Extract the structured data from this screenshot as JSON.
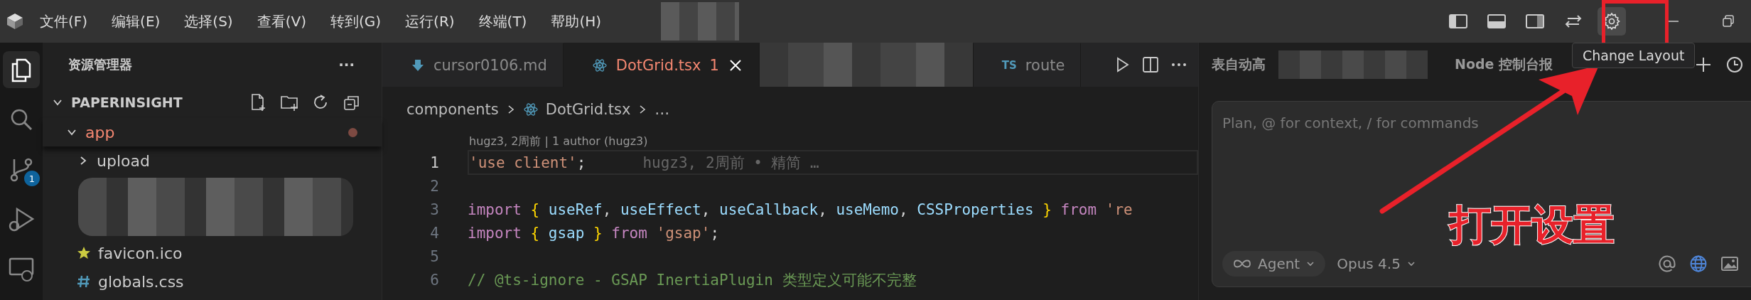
{
  "menu": [
    "文件(F)",
    "编辑(E)",
    "选择(S)",
    "查看(V)",
    "转到(G)",
    "运行(R)",
    "终端(T)",
    "帮助(H)"
  ],
  "title_bar_icons": [
    {
      "kind": "sidebar-left",
      "selected": false
    },
    {
      "kind": "panel",
      "selected": false
    },
    {
      "kind": "sidebar-right",
      "selected": false
    },
    {
      "kind": "swap",
      "selected": false
    },
    {
      "kind": "gear",
      "selected": true
    }
  ],
  "activity_bar": [
    {
      "kind": "explorer",
      "selected": true
    },
    {
      "kind": "search",
      "selected": false
    },
    {
      "kind": "source-control",
      "selected": false,
      "badge": "1"
    },
    {
      "kind": "debug",
      "selected": false
    },
    {
      "kind": "remote",
      "selected": false
    }
  ],
  "sidebar": {
    "title": "资源管理器",
    "more": "···",
    "root": {
      "label": "PAPERINSIGHT",
      "expanded": true,
      "children": [
        {
          "kind": "folder",
          "label": "app",
          "expanded": true,
          "modified": true,
          "children": [
            {
              "kind": "folder",
              "label": "upload",
              "expanded": false
            },
            {
              "kind": "redacted"
            },
            {
              "kind": "favicon",
              "label": "favicon.ico"
            },
            {
              "kind": "css",
              "label": "globals.css"
            }
          ]
        }
      ]
    }
  },
  "editor": {
    "tabs": [
      {
        "kind": "md",
        "label": "cursor0106.md",
        "selected": false
      },
      {
        "kind": "react",
        "label": "DotGrid.tsx",
        "problems": "1",
        "selected": true
      },
      {
        "kind": "redacted"
      },
      {
        "kind": "ts",
        "icon_text": "TS",
        "label": "route",
        "selected": false
      }
    ],
    "breadcrumb": [
      "components",
      "DotGrid.tsx",
      "…"
    ],
    "codelens": "hugz3, 2周前 | 1 author (hugz3)",
    "lines": [
      {
        "number": "1",
        "current": true,
        "blame": "hugz3, 2周前 • 精简 …",
        "tokens": [
          {
            "kind": "string",
            "text": "'use client'"
          },
          {
            "kind": "punct",
            "text": ";"
          }
        ]
      },
      {
        "number": "2",
        "current": false
      },
      {
        "number": "3",
        "current": false,
        "tokens": [
          {
            "kind": "keyword",
            "text": "import "
          },
          {
            "kind": "brace",
            "text": "{ "
          },
          {
            "kind": "ident",
            "text": "useRef"
          },
          {
            "kind": "punct",
            "text": ", "
          },
          {
            "kind": "ident",
            "text": "useEffect"
          },
          {
            "kind": "punct",
            "text": ", "
          },
          {
            "kind": "ident",
            "text": "useCallback"
          },
          {
            "kind": "punct",
            "text": ", "
          },
          {
            "kind": "ident",
            "text": "useMemo"
          },
          {
            "kind": "punct",
            "text": ", "
          },
          {
            "kind": "ident",
            "text": "CSSProperties"
          },
          {
            "kind": "brace",
            "text": " } "
          },
          {
            "kind": "keyword",
            "text": "from "
          },
          {
            "kind": "string",
            "text": "'re"
          }
        ]
      },
      {
        "number": "4",
        "current": false,
        "tokens": [
          {
            "kind": "keyword",
            "text": "import "
          },
          {
            "kind": "brace",
            "text": "{ "
          },
          {
            "kind": "ident",
            "text": "gsap"
          },
          {
            "kind": "brace",
            "text": " } "
          },
          {
            "kind": "keyword",
            "text": "from "
          },
          {
            "kind": "string",
            "text": "'gsap'"
          },
          {
            "kind": "punct",
            "text": ";"
          }
        ]
      },
      {
        "number": "5",
        "current": false
      },
      {
        "number": "6",
        "current": false,
        "tokens": [
          {
            "kind": "comment",
            "text": "// @ts-ignore - GSAP InertiaPlugin 类型定义可能不完整"
          }
        ]
      }
    ]
  },
  "chat": {
    "tabs": [
      {
        "kind": "text",
        "label": "表自动高"
      },
      {
        "kind": "redacted"
      },
      {
        "kind": "text",
        "label": "Node 控制台报"
      }
    ],
    "placeholder": "Plan, @ for context, / for commands",
    "mode": "Agent",
    "model": "Opus 4.5"
  },
  "tooltip": "Change Layout",
  "annotation": {
    "label": "打开设置"
  }
}
